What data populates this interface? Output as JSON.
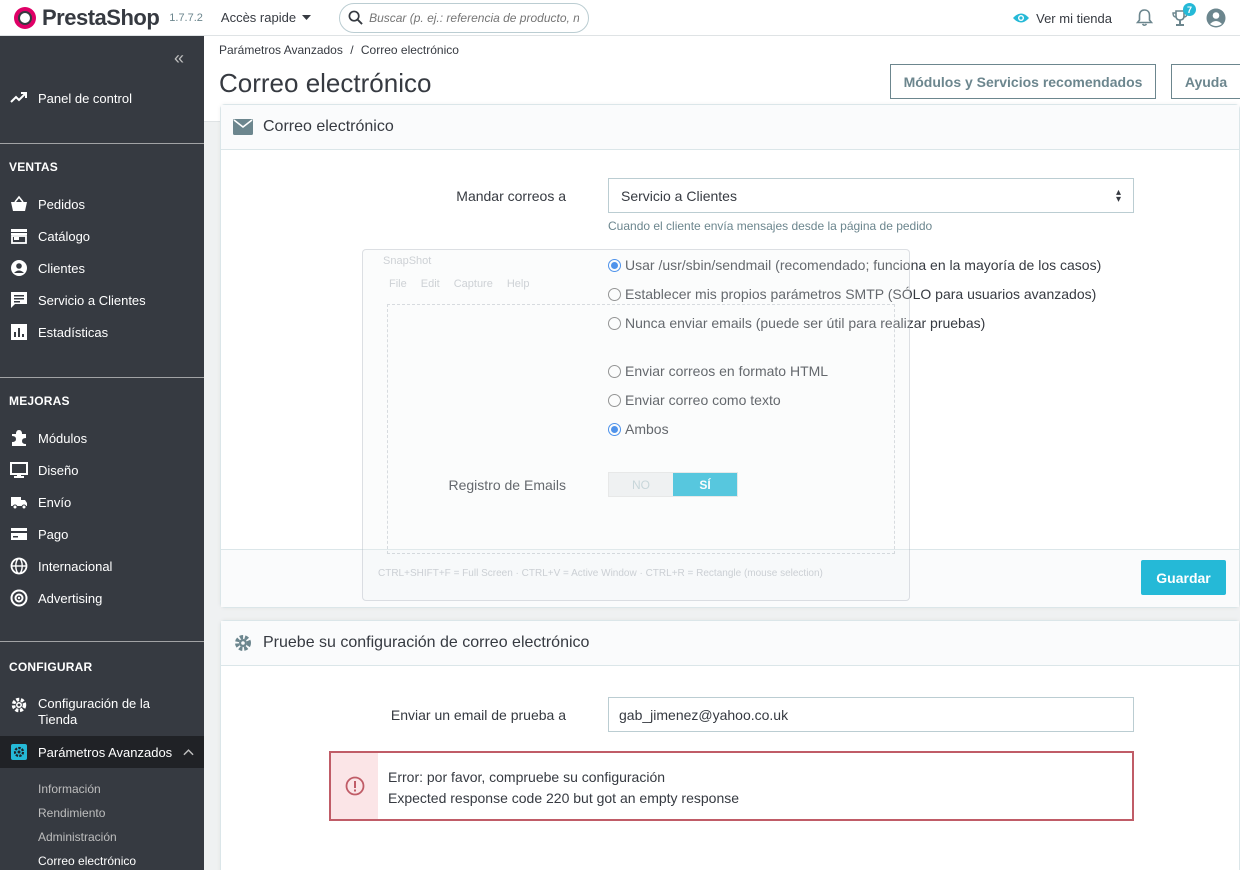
{
  "header": {
    "brand": "PrestaShop",
    "version": "1.7.7.2",
    "quick_access": "Accès rapide",
    "search_placeholder": "Buscar (p. ej.: referencia de producto, no",
    "view_store": "Ver mi tienda",
    "notifications_count": "7"
  },
  "sidebar": {
    "dashboard": "Panel de control",
    "sections": {
      "ventas": "VENTAS",
      "mejoras": "MEJORAS",
      "configurar": "CONFIGURAR"
    },
    "ventas_items": [
      "Pedidos",
      "Catálogo",
      "Clientes",
      "Servicio a Clientes",
      "Estadísticas"
    ],
    "mejoras_items": [
      "Módulos",
      "Diseño",
      "Envío",
      "Pago",
      "Internacional",
      "Advertising"
    ],
    "config_store": "Configuración de la Tienda",
    "advanced": "Parámetros Avanzados",
    "advanced_sub": [
      "Información",
      "Rendimiento",
      "Administración",
      "Correo electrónico"
    ]
  },
  "page": {
    "breadcrumb_parent": "Parámetros Avanzados",
    "breadcrumb_sep": "/",
    "breadcrumb_current": "Correo electrónico",
    "title": "Correo electrónico",
    "btn_modules": "Módulos y Servicios recomendados",
    "btn_help": "Ayuda"
  },
  "email_panel": {
    "heading": "Correo electrónico",
    "send_to_label": "Mandar correos a",
    "send_to_value": "Servicio a Clientes",
    "send_to_help": "Cuando el cliente envía mensajes desde la página de pedido",
    "method_options": [
      "Usar /usr/sbin/sendmail (recomendado; funciona en la mayoría de los casos)",
      "Establecer mis propios parámetros SMTP (SÓLO para usuarios avanzados)",
      "Nunca enviar emails (puede ser útil para realizar pruebas)"
    ],
    "method_selected": 0,
    "format_options": [
      "Enviar correos en formato HTML",
      "Enviar correo como texto",
      "Ambos"
    ],
    "format_selected": 2,
    "log_label": "Registro de Emails",
    "toggle_no": "NO",
    "toggle_yes": "SÍ",
    "save": "Guardar"
  },
  "test_panel": {
    "heading": "Pruebe su configuración de correo electrónico",
    "label": "Enviar un email de prueba a",
    "value": "gab_jimenez@yahoo.co.uk",
    "error_line1": "Error: por favor, compruebe su configuración",
    "error_line2": "Expected response code 220 but got an empty response"
  },
  "snapshot_overlay": {
    "title": "SnapShot",
    "menu": [
      "File",
      "Edit",
      "Capture",
      "Help"
    ],
    "footer": "CTRL+SHIFT+F = Full Screen  ·  CTRL+V = Active Window  ·  CTRL+R = Rectangle (mouse selection)"
  },
  "colors": {
    "accent": "#25b9d7",
    "sidebar": "#363a41",
    "error": "#c05c67",
    "brand": "#df0067"
  }
}
